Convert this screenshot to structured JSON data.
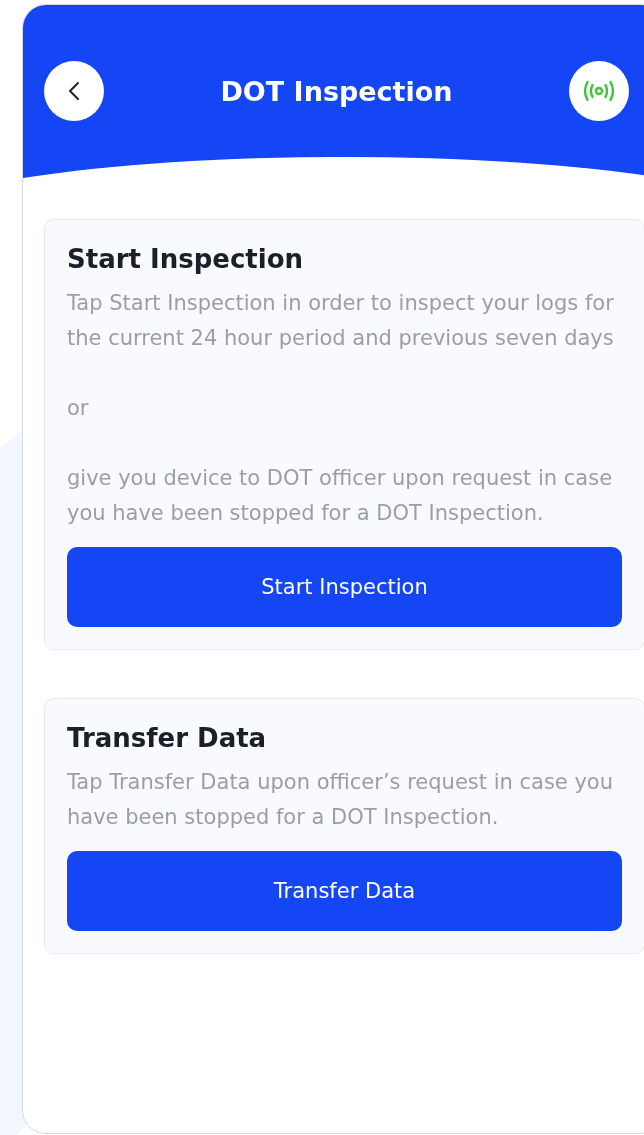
{
  "header": {
    "title": "DOT Inspection"
  },
  "cards": [
    {
      "title": "Start Inspection",
      "paragraphs": [
        "Tap Start Inspection in order to inspect your logs for the current 24 hour period and previous seven days",
        "or",
        "give you device to DOT officer upon request in case you have been stopped for a DOT Inspection."
      ],
      "button": "Start Inspection"
    },
    {
      "title": "Transfer Data",
      "paragraphs": [
        "Tap Transfer Data upon officer’s request in case you have been stopped for a DOT Inspection."
      ],
      "button": "Transfer Data"
    }
  ]
}
